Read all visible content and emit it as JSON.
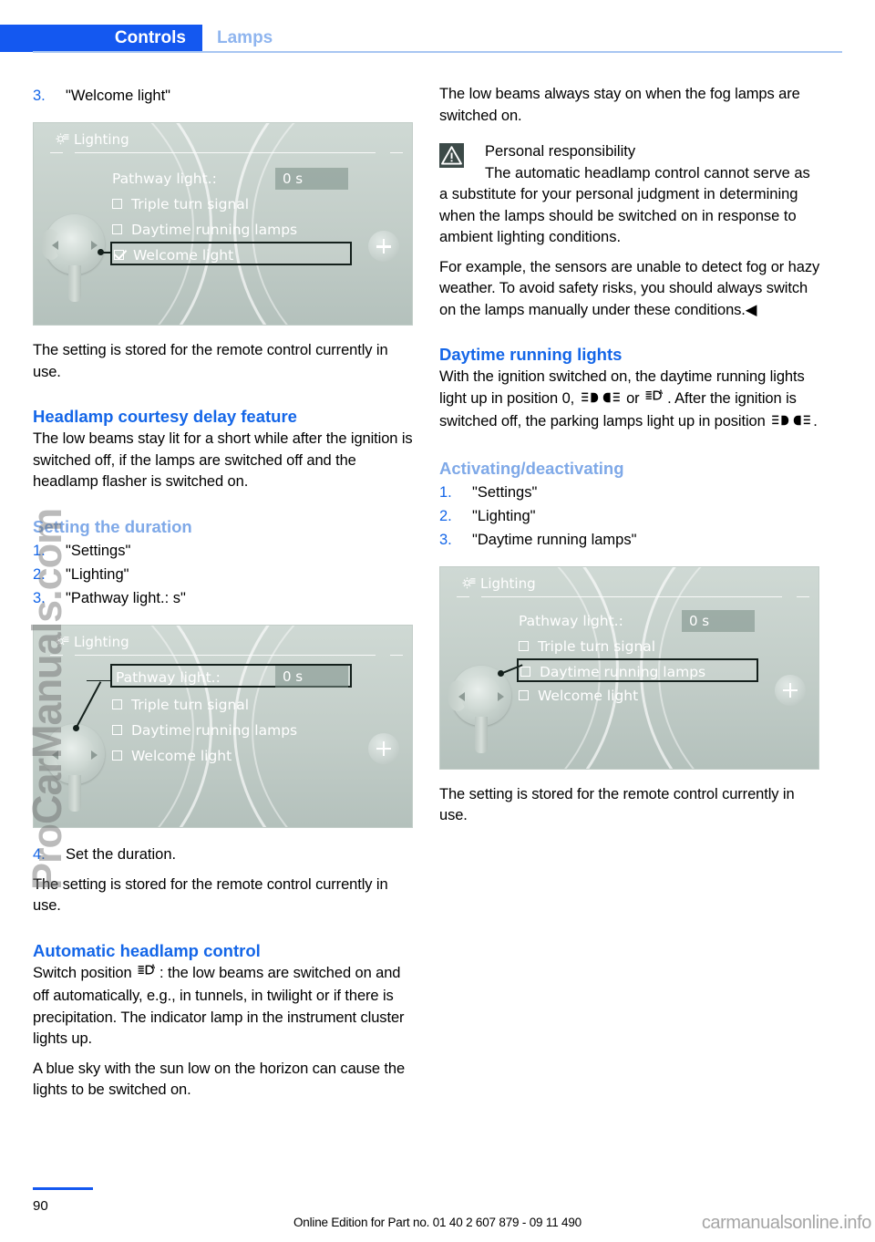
{
  "header": {
    "active_tab": "Controls",
    "inactive_tab": "Lamps",
    "accent_color": "#1458f0",
    "inactive_color": "#8fb5ef"
  },
  "left_column": {
    "step3": {
      "num": "3.",
      "text": "\"Welcome light\""
    },
    "screen1": {
      "title": "Lighting",
      "label": "Pathway light.:",
      "value": "0 s",
      "rows": [
        {
          "label": "Triple turn signal",
          "checked": false,
          "selected": false
        },
        {
          "label": "Daytime running lamps",
          "checked": false,
          "selected": false
        },
        {
          "label": "Welcome light",
          "checked": true,
          "selected": true
        }
      ]
    },
    "stored_note": "The setting is stored for the remote control currently in use.",
    "heading_courtesy": "Headlamp courtesy delay feature",
    "courtesy_body": "The low beams stay lit for a short while after the ignition is switched off, if the lamps are switched off and the headlamp flasher is switched on.",
    "heading_duration": "Setting the duration",
    "duration_steps": [
      {
        "num": "1.",
        "text": "\"Settings\""
      },
      {
        "num": "2.",
        "text": "\"Lighting\""
      },
      {
        "num": "3.",
        "text": "\"Pathway light.: s\""
      }
    ],
    "screen2": {
      "title": "Lighting",
      "label": "Pathway light.:",
      "value": "0 s",
      "rows": [
        {
          "label": "Triple turn signal",
          "checked": false,
          "selected": false
        },
        {
          "label": "Daytime running lamps",
          "checked": false,
          "selected": false
        },
        {
          "label": "Welcome light",
          "checked": false,
          "selected": false
        }
      ]
    },
    "step4": {
      "num": "4.",
      "text": "Set the duration."
    },
    "stored_note2": "The setting is stored for the remote control currently in use.",
    "heading_auto": "Automatic headlamp control",
    "auto_body_pre": "Switch position",
    "auto_body_post": ": the low beams are switched on and off automatically, e.g., in tunnels, in twilight or if there is precipitation. The indicator lamp in the instrument cluster lights up.",
    "auto_body_2": "A blue sky with the sun low on the horizon can cause the lights to be switched on."
  },
  "right_column": {
    "fog_note": "The low beams always stay on when the fog lamps are switched on.",
    "warning": {
      "title": "Personal responsibility",
      "body": "The automatic headlamp control cannot serve as a substitute for your personal judgment in determining when the lamps should be switched on in response to ambient lighting conditions.",
      "body2": "For example, the sensors are unable to detect fog or hazy weather. To avoid safety risks, you should always switch on the lamps manually under these conditions.",
      "end_marker": "◀",
      "icon_color": "#3c4a48"
    },
    "heading_drl": "Daytime running lights",
    "drl_body_1": "With the ignition switched on, the daytime running lights light up in position 0,",
    "drl_body_or": "or",
    "drl_body_2": "After the ignition is switched off, the parking lamps light up in position",
    "drl_body_end": ".",
    "heading_activating": "Activating/deactivating",
    "activating_steps": [
      {
        "num": "1.",
        "text": "\"Settings\""
      },
      {
        "num": "2.",
        "text": "\"Lighting\""
      },
      {
        "num": "3.",
        "text": "\"Daytime running lamps\""
      }
    ],
    "screen3": {
      "title": "Lighting",
      "label": "Pathway light.:",
      "value": "0 s",
      "rows": [
        {
          "label": "Triple turn signal",
          "checked": false,
          "selected": false
        },
        {
          "label": "Daytime running lamps",
          "checked": false,
          "selected": true
        },
        {
          "label": "Welcome light",
          "checked": false,
          "selected": false
        }
      ]
    },
    "stored_note": "The setting is stored for the remote control currently in use."
  },
  "footer": {
    "page_number": "90",
    "edition_text": "Online Edition for Part no. 01 40 2 607 879 - 09 11 490"
  },
  "watermarks": {
    "vertical": "ProCarManuals.com",
    "footer": "carmanualsonline.info"
  }
}
